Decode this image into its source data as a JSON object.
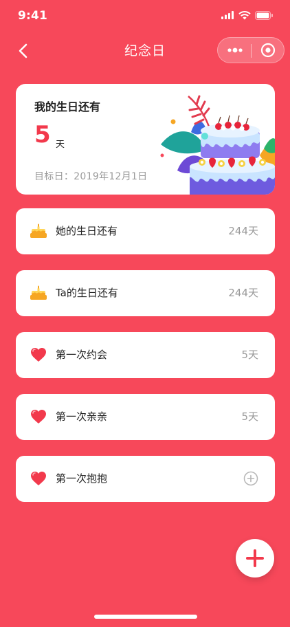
{
  "status_bar": {
    "time": "9:41"
  },
  "nav": {
    "title": "纪念日"
  },
  "hero": {
    "title": "我的生日还有",
    "days": "5",
    "unit": "天",
    "target_date": "目标日：2019年12月1日",
    "art_icon": "birthday-cake-illustration"
  },
  "items": [
    {
      "icon": "cake-icon",
      "label": "她的生日还有",
      "value": "244天"
    },
    {
      "icon": "cake-icon",
      "label": "Ta的生日还有",
      "value": "244天"
    },
    {
      "icon": "heart-icon",
      "label": "第一次约会",
      "value": "5天"
    },
    {
      "icon": "heart-icon",
      "label": "第一次亲亲",
      "value": "5天"
    },
    {
      "icon": "heart-icon",
      "label": "第一次抱抱",
      "value": ""
    }
  ],
  "colors": {
    "background": "#F7485A",
    "accent": "#F2394C",
    "card": "#FFFFFF",
    "muted_text": "#9A9A9A"
  }
}
